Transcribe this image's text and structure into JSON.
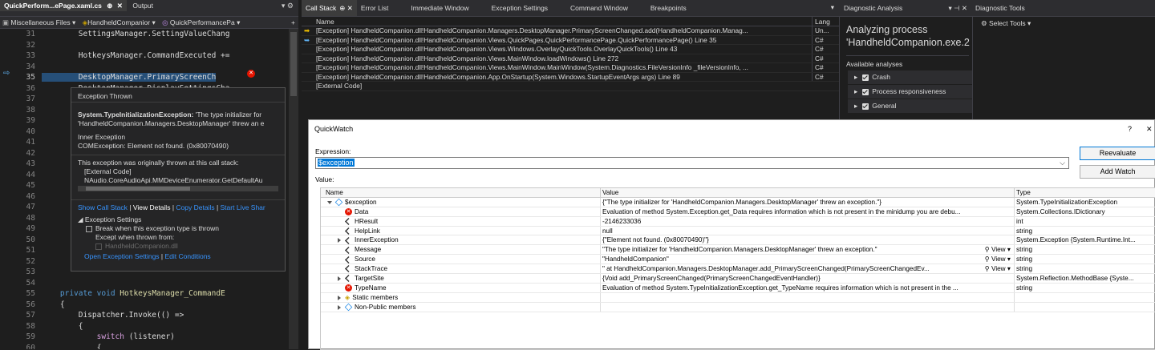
{
  "editor": {
    "active_tab": "QuickPerform...ePage.xaml.cs",
    "tab2": "Output",
    "nav_left": "Miscellaneous Files",
    "nav_mid": "HandheldCompanior",
    "nav_right": "QuickPerformancePa",
    "lines": [
      {
        "n": "31",
        "t": "        SettingsManager.SettingValueChang"
      },
      {
        "n": "32",
        "t": ""
      },
      {
        "n": "33",
        "t": "        HotkeysManager.CommandExecuted +="
      },
      {
        "n": "34",
        "t": ""
      },
      {
        "n": "35",
        "t": "        DesktopManager.PrimaryScreenCh"
      },
      {
        "n": "36",
        "t": "        DesktopManager.DisplaySettingsCha"
      },
      {
        "n": "37",
        "t": ""
      },
      {
        "n": "38",
        "t": ""
      },
      {
        "n": "39",
        "t": ""
      },
      {
        "n": "40",
        "t": ""
      },
      {
        "n": "41",
        "t": ""
      },
      {
        "n": "42",
        "t": ""
      },
      {
        "n": "43",
        "t": ""
      },
      {
        "n": "44",
        "t": ""
      },
      {
        "n": "45",
        "t": ""
      },
      {
        "n": "46",
        "t": ""
      },
      {
        "n": "47",
        "t": ""
      },
      {
        "n": "48",
        "t": ""
      },
      {
        "n": "49",
        "t": ""
      },
      {
        "n": "50",
        "t": ""
      },
      {
        "n": "51",
        "t": ""
      },
      {
        "n": "52",
        "t": ""
      },
      {
        "n": "53",
        "t": ""
      },
      {
        "n": "54",
        "t": ""
      },
      {
        "n": "55",
        "t": "    private void HotkeysManager_CommandE"
      },
      {
        "n": "56",
        "t": "    {"
      },
      {
        "n": "57",
        "t": "        Dispatcher.Invoke(() =>"
      },
      {
        "n": "58",
        "t": "        {"
      },
      {
        "n": "59",
        "t": "            switch (listener)"
      },
      {
        "n": "60",
        "t": "            {"
      }
    ]
  },
  "exception_popup": {
    "title": "Exception Thrown",
    "type": "System.TypeInitializationException:",
    "msg1": " 'The type initializer for",
    "msg2": "'HandheldCompanion.Managers.DesktopManager' threw an e",
    "inner_label": "Inner Exception",
    "inner": "COMException: Element not found. (0x80070490)",
    "orig": "This exception was originally thrown at this call stack:",
    "ext": "[External Code]",
    "naudio": "NAudio.CoreAudioApi.MMDeviceEnumerator.GetDefaultAu",
    "links": [
      "Show Call Stack",
      "View Details",
      "Copy Details",
      "Start Live Shar"
    ],
    "settings_title": "Exception Settings",
    "break_label": "Break when this exception type is thrown",
    "except_label": "Except when thrown from:",
    "dll": "HandheldCompanion.dll",
    "open_settings": "Open Exception Settings",
    "edit_cond": "Edit Conditions"
  },
  "callstack": {
    "tabs": [
      "Call Stack",
      "Error List",
      "Immediate Window",
      "Exception Settings",
      "Command Window",
      "Breakpoints"
    ],
    "col_name": "Name",
    "col_lang": "Lang",
    "rows": [
      {
        "name": "[Exception] HandheldCompanion.dll!HandheldCompanion.Managers.DesktopManager.PrimaryScreenChanged.add(HandheldCompanion.Manag...",
        "lang": "Un..."
      },
      {
        "name": "[Exception] HandheldCompanion.dll!HandheldCompanion.Views.QuickPages.QuickPerformancePage.QuickPerformancePage() Line 35",
        "lang": "C#"
      },
      {
        "name": "[Exception] HandheldCompanion.dll!HandheldCompanion.Views.Windows.OverlayQuickTools.OverlayQuickTools() Line 43",
        "lang": "C#"
      },
      {
        "name": "[Exception] HandheldCompanion.dll!HandheldCompanion.Views.MainWindow.loadWindows() Line 272",
        "lang": "C#"
      },
      {
        "name": "[Exception] HandheldCompanion.dll!HandheldCompanion.Views.MainWindow.MainWindow(System.Diagnostics.FileVersionInfo _fileVersionInfo, ...",
        "lang": "C#"
      },
      {
        "name": "[Exception] HandheldCompanion.dll!HandheldCompanion.App.OnStartup(System.Windows.StartupEventArgs args) Line 89",
        "lang": "C#"
      },
      {
        "name": "[External Code]",
        "lang": ""
      }
    ]
  },
  "diag": {
    "tab": "Diagnostic Analysis",
    "title1": "Analyzing process",
    "title2": "'HandheldCompanion.exe.2",
    "available": "Available analyses",
    "items": [
      "Crash",
      "Process responsiveness",
      "General"
    ]
  },
  "tools": {
    "tab": "Diagnostic Tools",
    "select": "Select Tools"
  },
  "quickwatch": {
    "title": "QuickWatch",
    "help": "?",
    "expr_label": "Expression:",
    "expr_value": "$exception",
    "value_label": "Value:",
    "reevaluate": "Reevaluate",
    "add_watch": "Add Watch",
    "cols": [
      "Name",
      "Value",
      "Type"
    ],
    "rows": [
      {
        "indent": 0,
        "exp": "down",
        "icon": "obj",
        "name": "$exception",
        "value": "{\"The type initializer for 'HandheldCompanion.Managers.DesktopManager' threw an exception.\"}",
        "type": "System.TypeInitializationException",
        "view": false
      },
      {
        "indent": 1,
        "exp": "",
        "icon": "err",
        "name": "Data",
        "value": "Evaluation of method System.Exception.get_Data requires information which is not present in the minidump you are debu...",
        "type": "System.Collections.IDictionary",
        "view": false
      },
      {
        "indent": 1,
        "exp": "",
        "icon": "wrench",
        "name": "HResult",
        "value": "-2146233036",
        "type": "int",
        "view": false
      },
      {
        "indent": 1,
        "exp": "",
        "icon": "wrench",
        "name": "HelpLink",
        "value": "null",
        "type": "string",
        "view": false
      },
      {
        "indent": 1,
        "exp": "right",
        "icon": "wrench",
        "name": "InnerException",
        "value": "{\"Element not found. (0x80070490)\"}",
        "type": "System.Exception {System.Runtime.Int...",
        "view": false
      },
      {
        "indent": 1,
        "exp": "",
        "icon": "wrench",
        "name": "Message",
        "value": "\"The type initializer for 'HandheldCompanion.Managers.DesktopManager' threw an exception.\"",
        "type": "string",
        "view": true
      },
      {
        "indent": 1,
        "exp": "",
        "icon": "wrench",
        "name": "Source",
        "value": "\"HandheldCompanion\"",
        "type": "string",
        "view": true
      },
      {
        "indent": 1,
        "exp": "",
        "icon": "wrench",
        "name": "StackTrace",
        "value": "\"   at HandheldCompanion.Managers.DesktopManager.add_PrimaryScreenChanged(PrimaryScreenChangedEv...",
        "type": "string",
        "view": true
      },
      {
        "indent": 1,
        "exp": "right",
        "icon": "wrench",
        "name": "TargetSite",
        "value": "{Void add_PrimaryScreenChanged(PrimaryScreenChangedEventHandler)}",
        "type": "System.Reflection.MethodBase {Syste...",
        "view": false
      },
      {
        "indent": 1,
        "exp": "",
        "icon": "err",
        "name": "TypeName",
        "value": "Evaluation of method System.TypeInitializationException.get_TypeName requires information which is not present in the ...",
        "type": "string",
        "view": false
      },
      {
        "indent": 1,
        "exp": "right",
        "icon": "static",
        "name": "Static members",
        "value": "",
        "type": "",
        "view": false
      },
      {
        "indent": 1,
        "exp": "right",
        "icon": "obj",
        "name": "Non-Public members",
        "value": "",
        "type": "",
        "view": false
      }
    ],
    "view_label": "View"
  },
  "colors": {
    "accent": "#007acc",
    "selection": "#0078d7",
    "error": "#e51400"
  }
}
